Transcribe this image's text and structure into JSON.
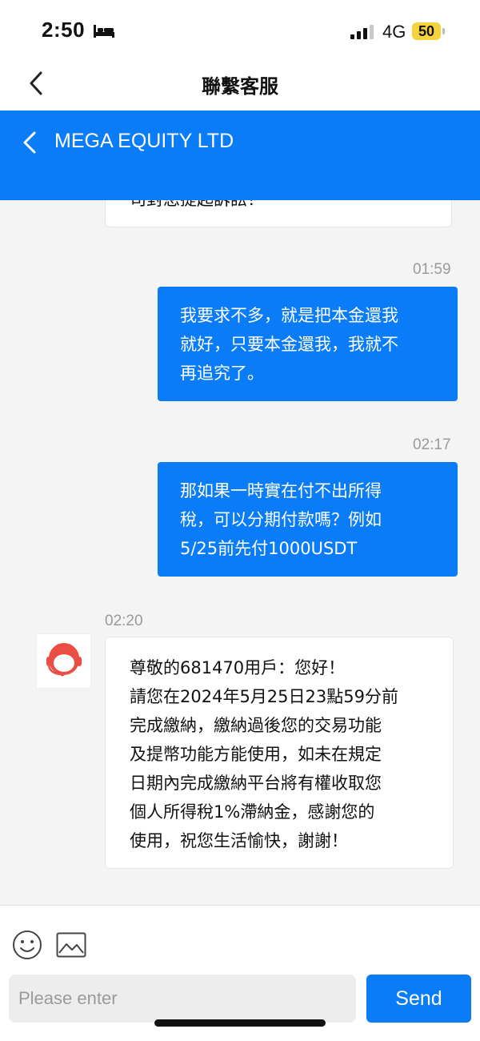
{
  "status_bar": {
    "time": "2:50",
    "network": "4G",
    "battery": "50"
  },
  "nav": {
    "title": "聯繫客服"
  },
  "header": {
    "company": "MEGA EQUITY LTD"
  },
  "messages": [
    {
      "direction": "in",
      "time": "",
      "text": "司對您提起訴訟！"
    },
    {
      "direction": "out",
      "time": "01:59",
      "text": "我要求不多，就是把本金還我\n就好，只要本金還我，我就不\n再追究了。"
    },
    {
      "direction": "out",
      "time": "02:17",
      "text": "那如果一時實在付不出所得\n稅，可以分期付款嗎？例如\n5/25前先付1000USDT"
    },
    {
      "direction": "in",
      "time": "02:20",
      "text": "尊敬的681470用戶：您好！\n請您在2024年5月25日23點59分前\n完成繳納，繳納過後您的交易功能\n及提幣功能方能使用，如未在規定\n日期內完成繳納平台將有權收取您\n個人所得稅1%滯納金，感謝您的\n使用，祝您生活愉快，謝謝！"
    }
  ],
  "composer": {
    "placeholder": "Please enter",
    "send_label": "Send"
  },
  "colors": {
    "accent": "#0a7cf7",
    "chat_bg": "#f4f4f4"
  }
}
